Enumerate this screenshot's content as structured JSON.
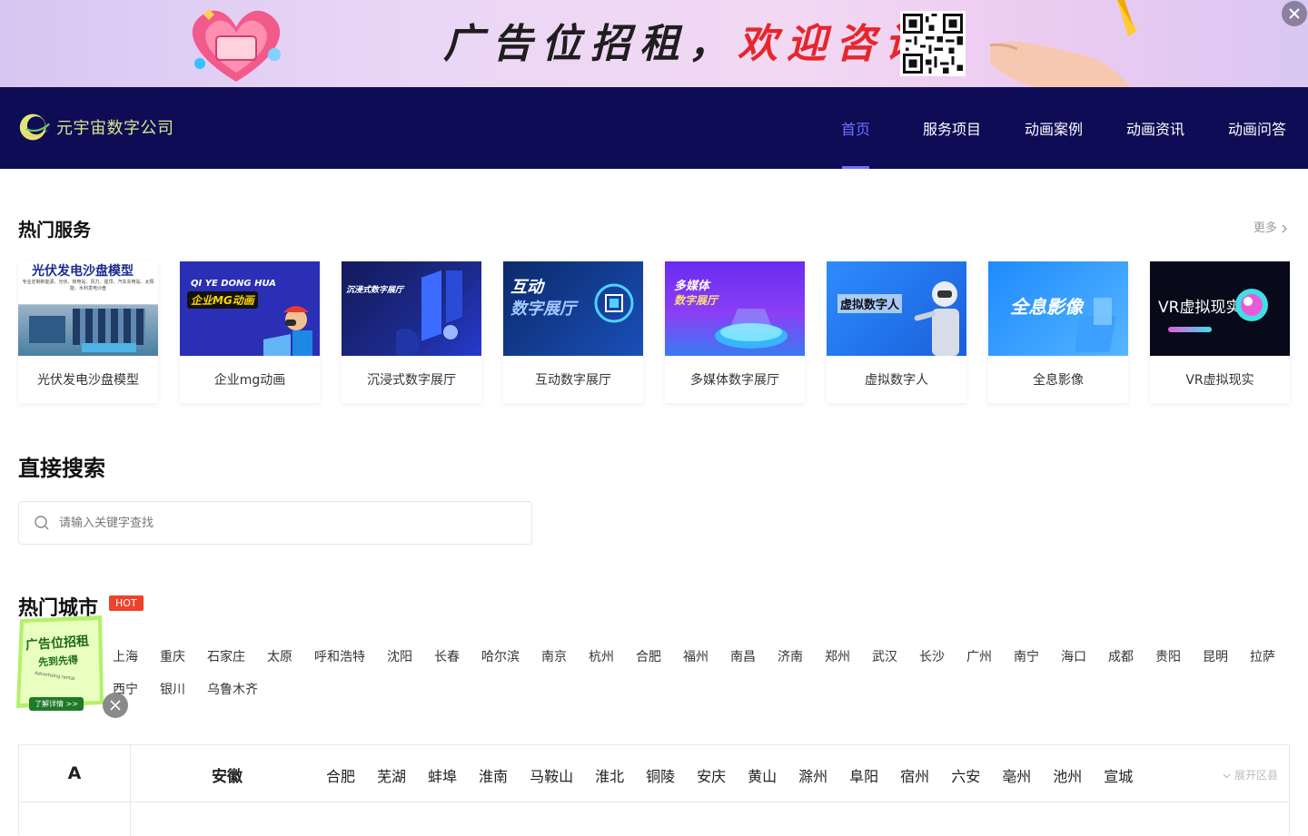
{
  "ad_banner": {
    "text_black": "广告位招租，",
    "text_red": "欢迎咨询"
  },
  "nav": {
    "logo_text": "元宇宙数字公司",
    "items": [
      {
        "label": "首页",
        "active": true
      },
      {
        "label": "服务项目",
        "active": false
      },
      {
        "label": "动画案例",
        "active": false
      },
      {
        "label": "动画资讯",
        "active": false
      },
      {
        "label": "动画问答",
        "active": false
      }
    ]
  },
  "hot_services": {
    "title": "热门服务",
    "more": "更多",
    "cards": [
      {
        "label": "光伏发电沙盘模型",
        "image_text": "光伏发电沙盘模型",
        "image_subtext": "专业定制新能源、光伏、核电站、风力、屋顶、汽车充电站、太阳能、水利发电沙盘"
      },
      {
        "label": "企业mg动画",
        "image_text": "QI YE DONG HUA",
        "image_subtext": "企业MG动画"
      },
      {
        "label": "沉浸式数字展厅",
        "image_text": "沉浸式数字展厅"
      },
      {
        "label": "互动数字展厅",
        "image_text": "互动",
        "image_subtext": "数字展厅"
      },
      {
        "label": "多媒体数字展厅",
        "image_text": "多媒体",
        "image_subtext": "数字展厅"
      },
      {
        "label": "虚拟数字人",
        "image_text": "虚拟数字人"
      },
      {
        "label": "全息影像",
        "image_text": "全息影像"
      },
      {
        "label": "VR虚拟现实",
        "image_text": "VR虚拟现实"
      }
    ]
  },
  "search": {
    "title": "直接搜索",
    "placeholder": "请输入关键字查找"
  },
  "hot_cities": {
    "title": "热门城市",
    "badge": "HOT",
    "row1": [
      "上海",
      "重庆",
      "石家庄",
      "太原",
      "呼和浩特",
      "沈阳",
      "长春",
      "哈尔滨",
      "南京",
      "杭州",
      "合肥",
      "福州",
      "南昌",
      "济南",
      "郑州",
      "武汉",
      "长沙",
      "广州",
      "南宁",
      "海口",
      "成都",
      "贵阳",
      "昆明",
      "拉萨"
    ],
    "row2": [
      "西宁",
      "银川",
      "乌鲁木齐"
    ]
  },
  "float_ad": {
    "line1": "广告位招租",
    "line2": "先到先得",
    "line3": "Advertising rental",
    "button": "了解详情 >>"
  },
  "regions": {
    "letter": "A",
    "province": "安徽",
    "cities": [
      "合肥",
      "芜湖",
      "蚌埠",
      "淮南",
      "马鞍山",
      "淮北",
      "铜陵",
      "安庆",
      "黄山",
      "滁州",
      "阜阳",
      "宿州",
      "六安",
      "亳州",
      "池州",
      "宣城"
    ],
    "expand": "展开区县"
  }
}
